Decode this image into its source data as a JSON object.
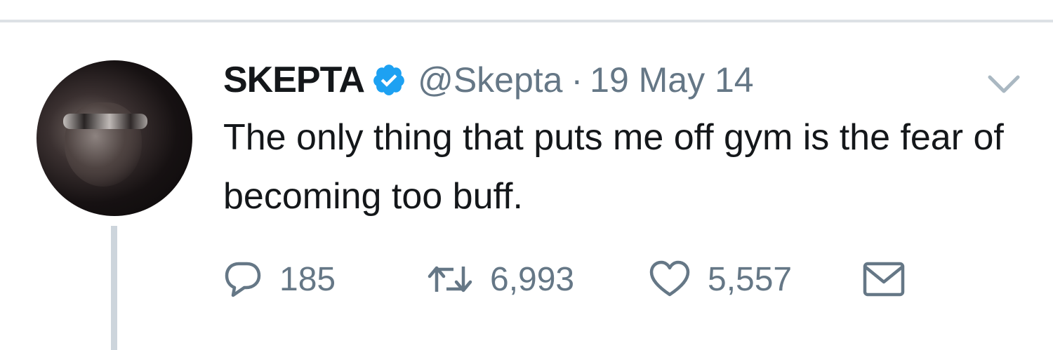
{
  "tweet": {
    "author_name": "SKEPTA",
    "verified": true,
    "handle": "@Skepta",
    "separator": "·",
    "date": "19 May 14",
    "text": "The only thing that puts me off gym is the fear of becoming too buff."
  },
  "actions": {
    "reply_count": "185",
    "retweet_count": "6,993",
    "like_count": "5,557"
  },
  "colors": {
    "text": "#14171a",
    "secondary": "#657786",
    "verified_blue": "#1da1f2",
    "thread_line": "#cdd5dc"
  },
  "icons": [
    "verified-badge-icon",
    "chevron-down-icon",
    "reply-icon",
    "retweet-icon",
    "like-icon",
    "direct-message-icon"
  ]
}
